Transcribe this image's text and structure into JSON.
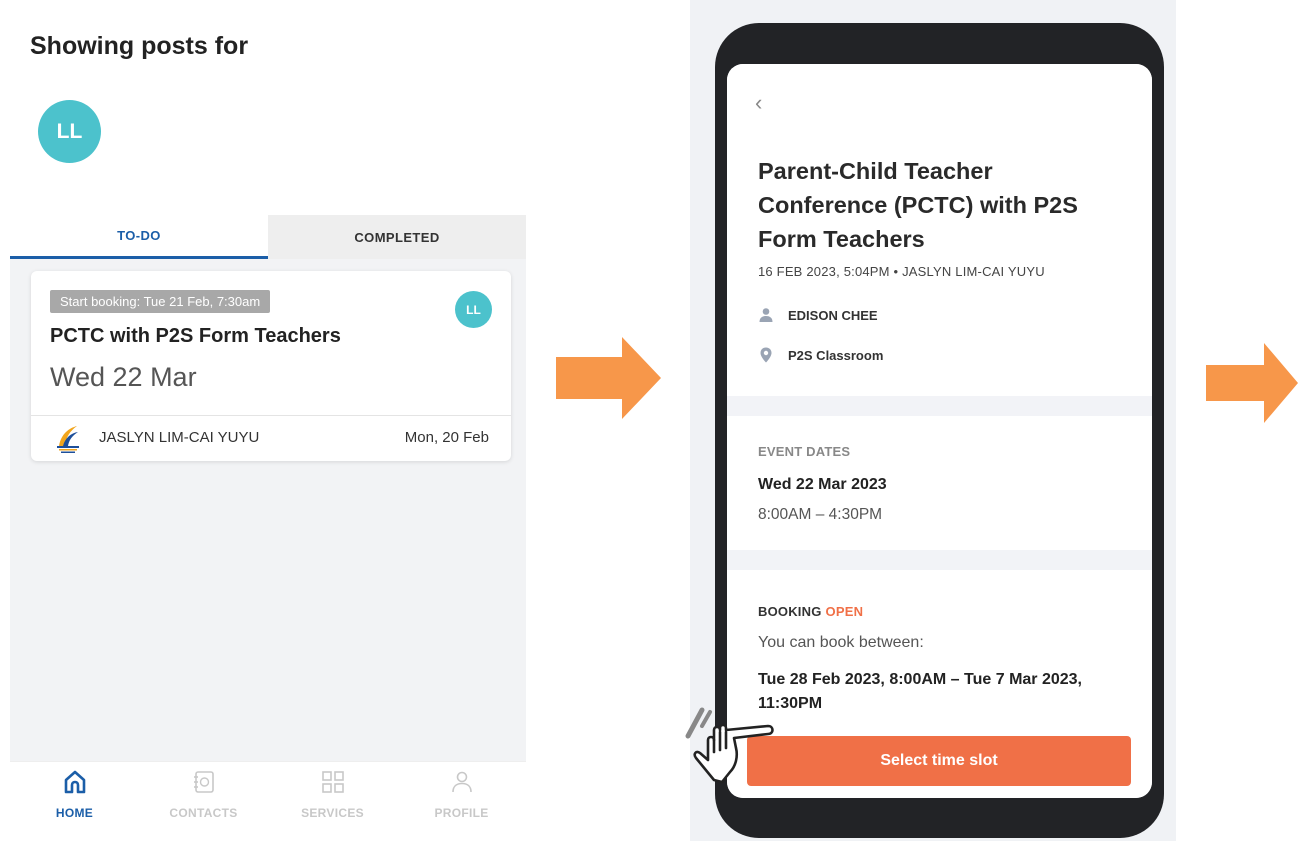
{
  "left": {
    "heading": "Showing posts for",
    "avatar_initials": "LL",
    "tabs": [
      {
        "label": "TO-DO",
        "active": true
      },
      {
        "label": "COMPLETED",
        "active": false
      }
    ],
    "card": {
      "tag": "Start booking: Tue 21 Feb, 7:30am",
      "avatar_initials": "LL",
      "title": "PCTC with P2S Form Teachers",
      "date": "Wed 22 Mar",
      "sender": "JASLYN LIM-CAI YUYU",
      "sent_date": "Mon, 20 Feb"
    },
    "nav": [
      {
        "label": "HOME",
        "icon": "home-icon",
        "active": true
      },
      {
        "label": "CONTACTS",
        "icon": "contacts-icon",
        "active": false
      },
      {
        "label": "SERVICES",
        "icon": "services-grid-icon",
        "active": false
      },
      {
        "label": "PROFILE",
        "icon": "profile-icon",
        "active": false
      }
    ]
  },
  "phone": {
    "back_icon": "chevron-left-icon",
    "title": "Parent-Child Teacher Conference (PCTC) with P2S Form Teachers",
    "meta": "16 FEB 2023, 5:04PM  •  JASLYN LIM-CAI YUYU",
    "teacher": "EDISON CHEE",
    "location": "P2S Classroom",
    "event_dates_label": "EVENT DATES",
    "event_date": "Wed 22 Mar 2023",
    "event_time": "8:00AM – 4:30PM",
    "booking_label": "BOOKING",
    "booking_status": "OPEN",
    "book_between": "You can book between:",
    "booking_range": "Tue 28 Feb 2023, 8:00AM – Tue 7 Mar 2023, 11:30PM",
    "cta": "Select time slot"
  },
  "colors": {
    "accent_blue": "#1b5ea8",
    "avatar_teal": "#4cc2cc",
    "cta_orange": "#f07047",
    "arrow_orange": "#f7974a"
  }
}
